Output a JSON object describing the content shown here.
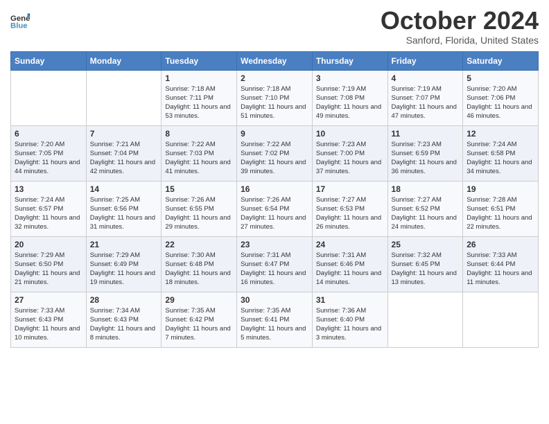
{
  "logo": {
    "line1": "General",
    "line2": "Blue"
  },
  "header": {
    "month": "October 2024",
    "location": "Sanford, Florida, United States"
  },
  "columns": [
    "Sunday",
    "Monday",
    "Tuesday",
    "Wednesday",
    "Thursday",
    "Friday",
    "Saturday"
  ],
  "weeks": [
    [
      {
        "day": "",
        "info": ""
      },
      {
        "day": "",
        "info": ""
      },
      {
        "day": "1",
        "sunrise": "Sunrise: 7:18 AM",
        "sunset": "Sunset: 7:11 PM",
        "daylight": "Daylight: 11 hours and 53 minutes."
      },
      {
        "day": "2",
        "sunrise": "Sunrise: 7:18 AM",
        "sunset": "Sunset: 7:10 PM",
        "daylight": "Daylight: 11 hours and 51 minutes."
      },
      {
        "day": "3",
        "sunrise": "Sunrise: 7:19 AM",
        "sunset": "Sunset: 7:08 PM",
        "daylight": "Daylight: 11 hours and 49 minutes."
      },
      {
        "day": "4",
        "sunrise": "Sunrise: 7:19 AM",
        "sunset": "Sunset: 7:07 PM",
        "daylight": "Daylight: 11 hours and 47 minutes."
      },
      {
        "day": "5",
        "sunrise": "Sunrise: 7:20 AM",
        "sunset": "Sunset: 7:06 PM",
        "daylight": "Daylight: 11 hours and 46 minutes."
      }
    ],
    [
      {
        "day": "6",
        "sunrise": "Sunrise: 7:20 AM",
        "sunset": "Sunset: 7:05 PM",
        "daylight": "Daylight: 11 hours and 44 minutes."
      },
      {
        "day": "7",
        "sunrise": "Sunrise: 7:21 AM",
        "sunset": "Sunset: 7:04 PM",
        "daylight": "Daylight: 11 hours and 42 minutes."
      },
      {
        "day": "8",
        "sunrise": "Sunrise: 7:22 AM",
        "sunset": "Sunset: 7:03 PM",
        "daylight": "Daylight: 11 hours and 41 minutes."
      },
      {
        "day": "9",
        "sunrise": "Sunrise: 7:22 AM",
        "sunset": "Sunset: 7:02 PM",
        "daylight": "Daylight: 11 hours and 39 minutes."
      },
      {
        "day": "10",
        "sunrise": "Sunrise: 7:23 AM",
        "sunset": "Sunset: 7:00 PM",
        "daylight": "Daylight: 11 hours and 37 minutes."
      },
      {
        "day": "11",
        "sunrise": "Sunrise: 7:23 AM",
        "sunset": "Sunset: 6:59 PM",
        "daylight": "Daylight: 11 hours and 36 minutes."
      },
      {
        "day": "12",
        "sunrise": "Sunrise: 7:24 AM",
        "sunset": "Sunset: 6:58 PM",
        "daylight": "Daylight: 11 hours and 34 minutes."
      }
    ],
    [
      {
        "day": "13",
        "sunrise": "Sunrise: 7:24 AM",
        "sunset": "Sunset: 6:57 PM",
        "daylight": "Daylight: 11 hours and 32 minutes."
      },
      {
        "day": "14",
        "sunrise": "Sunrise: 7:25 AM",
        "sunset": "Sunset: 6:56 PM",
        "daylight": "Daylight: 11 hours and 31 minutes."
      },
      {
        "day": "15",
        "sunrise": "Sunrise: 7:26 AM",
        "sunset": "Sunset: 6:55 PM",
        "daylight": "Daylight: 11 hours and 29 minutes."
      },
      {
        "day": "16",
        "sunrise": "Sunrise: 7:26 AM",
        "sunset": "Sunset: 6:54 PM",
        "daylight": "Daylight: 11 hours and 27 minutes."
      },
      {
        "day": "17",
        "sunrise": "Sunrise: 7:27 AM",
        "sunset": "Sunset: 6:53 PM",
        "daylight": "Daylight: 11 hours and 26 minutes."
      },
      {
        "day": "18",
        "sunrise": "Sunrise: 7:27 AM",
        "sunset": "Sunset: 6:52 PM",
        "daylight": "Daylight: 11 hours and 24 minutes."
      },
      {
        "day": "19",
        "sunrise": "Sunrise: 7:28 AM",
        "sunset": "Sunset: 6:51 PM",
        "daylight": "Daylight: 11 hours and 22 minutes."
      }
    ],
    [
      {
        "day": "20",
        "sunrise": "Sunrise: 7:29 AM",
        "sunset": "Sunset: 6:50 PM",
        "daylight": "Daylight: 11 hours and 21 minutes."
      },
      {
        "day": "21",
        "sunrise": "Sunrise: 7:29 AM",
        "sunset": "Sunset: 6:49 PM",
        "daylight": "Daylight: 11 hours and 19 minutes."
      },
      {
        "day": "22",
        "sunrise": "Sunrise: 7:30 AM",
        "sunset": "Sunset: 6:48 PM",
        "daylight": "Daylight: 11 hours and 18 minutes."
      },
      {
        "day": "23",
        "sunrise": "Sunrise: 7:31 AM",
        "sunset": "Sunset: 6:47 PM",
        "daylight": "Daylight: 11 hours and 16 minutes."
      },
      {
        "day": "24",
        "sunrise": "Sunrise: 7:31 AM",
        "sunset": "Sunset: 6:46 PM",
        "daylight": "Daylight: 11 hours and 14 minutes."
      },
      {
        "day": "25",
        "sunrise": "Sunrise: 7:32 AM",
        "sunset": "Sunset: 6:45 PM",
        "daylight": "Daylight: 11 hours and 13 minutes."
      },
      {
        "day": "26",
        "sunrise": "Sunrise: 7:33 AM",
        "sunset": "Sunset: 6:44 PM",
        "daylight": "Daylight: 11 hours and 11 minutes."
      }
    ],
    [
      {
        "day": "27",
        "sunrise": "Sunrise: 7:33 AM",
        "sunset": "Sunset: 6:43 PM",
        "daylight": "Daylight: 11 hours and 10 minutes."
      },
      {
        "day": "28",
        "sunrise": "Sunrise: 7:34 AM",
        "sunset": "Sunset: 6:43 PM",
        "daylight": "Daylight: 11 hours and 8 minutes."
      },
      {
        "day": "29",
        "sunrise": "Sunrise: 7:35 AM",
        "sunset": "Sunset: 6:42 PM",
        "daylight": "Daylight: 11 hours and 7 minutes."
      },
      {
        "day": "30",
        "sunrise": "Sunrise: 7:35 AM",
        "sunset": "Sunset: 6:41 PM",
        "daylight": "Daylight: 11 hours and 5 minutes."
      },
      {
        "day": "31",
        "sunrise": "Sunrise: 7:36 AM",
        "sunset": "Sunset: 6:40 PM",
        "daylight": "Daylight: 11 hours and 3 minutes."
      },
      {
        "day": "",
        "info": ""
      },
      {
        "day": "",
        "info": ""
      }
    ]
  ]
}
